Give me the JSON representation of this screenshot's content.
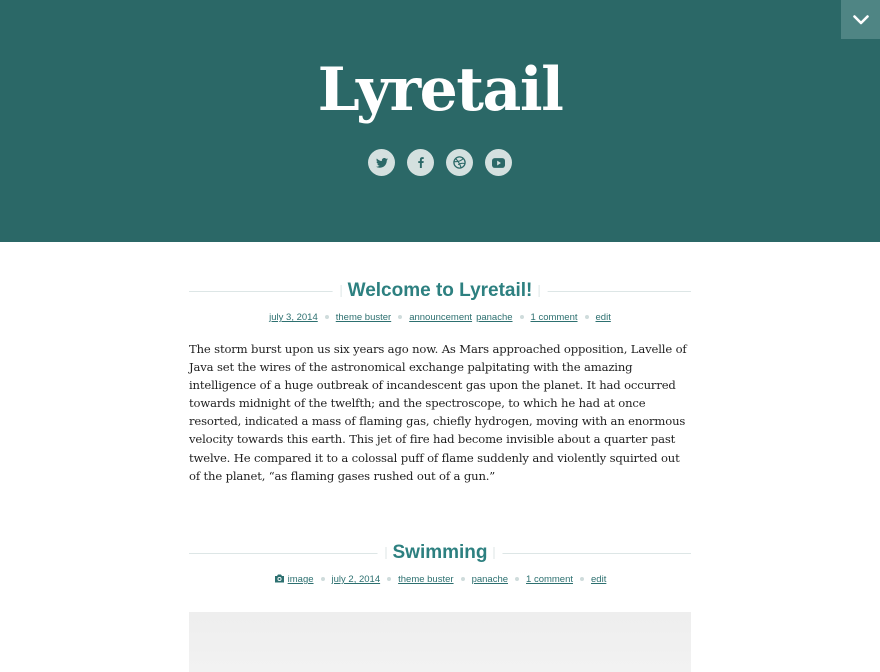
{
  "site": {
    "title": "Lyretail"
  },
  "header": {
    "toggle_icon": "chevron-down-icon",
    "social": [
      {
        "name": "twitter-icon"
      },
      {
        "name": "facebook-icon"
      },
      {
        "name": "dribbble-icon"
      },
      {
        "name": "youtube-icon"
      }
    ],
    "background_color": "#2b6867"
  },
  "posts": [
    {
      "title": "Welcome to Lyretail!",
      "meta": {
        "date": "july 3, 2014",
        "author": "theme buster",
        "categories": [
          "announcement",
          "panache"
        ],
        "comments": "1 comment",
        "edit": "edit"
      },
      "body": "The storm burst upon us six years ago now. As Mars approached opposition, Lavelle of Java set the wires of the astronomical exchange palpitating with the amazing intelligence of a huge outbreak of incandescent gas upon the planet. It had occurred towards midnight of the twelfth; and the spectroscope, to which he had at once resorted, indicated a mass of flaming gas, chiefly hydrogen, moving with an enormous velocity towards this earth. This jet of fire had become invisible about a quarter past twelve. He compared it to a colossal puff of flame suddenly and violently squirted out of the planet, “as flaming gases rushed out of a gun.”"
    },
    {
      "title": "Swimming",
      "meta": {
        "format_icon": "camera-icon",
        "format": "image",
        "date": "july 2, 2014",
        "author": "theme buster",
        "category": "panache",
        "comments": "1 comment",
        "edit": "edit"
      }
    }
  ],
  "colors": {
    "accent": "#2d8080",
    "meta_link": "#2d7070",
    "social_bg": "#d4e0df"
  }
}
